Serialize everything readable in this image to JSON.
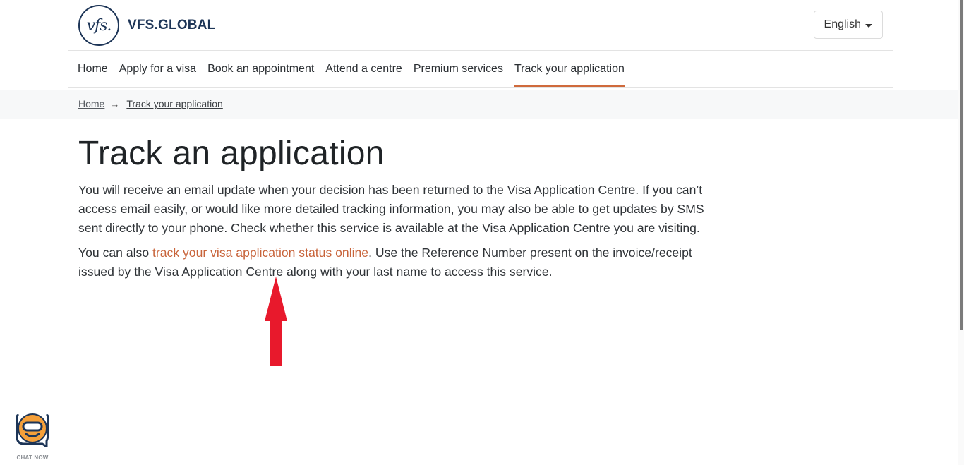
{
  "header": {
    "logo_mark": "vfs.",
    "logo_text": "VFS.GLOBAL",
    "language": "English"
  },
  "nav": {
    "items": [
      {
        "label": "Home",
        "active": false
      },
      {
        "label": "Apply for a visa",
        "active": false
      },
      {
        "label": "Book an appointment",
        "active": false
      },
      {
        "label": "Attend a centre",
        "active": false
      },
      {
        "label": "Premium services",
        "active": false
      },
      {
        "label": "Track your application",
        "active": true
      }
    ]
  },
  "breadcrumb": {
    "items": [
      "Home",
      "Track your application"
    ],
    "separator": "→"
  },
  "main": {
    "title": "Track an application",
    "paragraph1": "You will receive an email update when your decision has been returned to the Visa Application Centre. If you can’t access email easily, or would like more detailed tracking information, you may also be able to get updates by SMS sent directly to your phone. Check whether this service is available at the Visa Application Centre you are visiting.",
    "paragraph2_before": "You can also ",
    "paragraph2_link": "track your visa application status online",
    "paragraph2_after": ". Use the Reference Number present on the invoice/receipt issued by the Visa Application Centre along with your last name to access this service."
  },
  "chat": {
    "label": "CHAT NOW"
  },
  "colors": {
    "brand_navy": "#1d3557",
    "accent_orange": "#cf6a3c",
    "link_orange": "#c8643b",
    "annotation_red": "#e8192c",
    "chat_orange": "#f5a03a"
  }
}
